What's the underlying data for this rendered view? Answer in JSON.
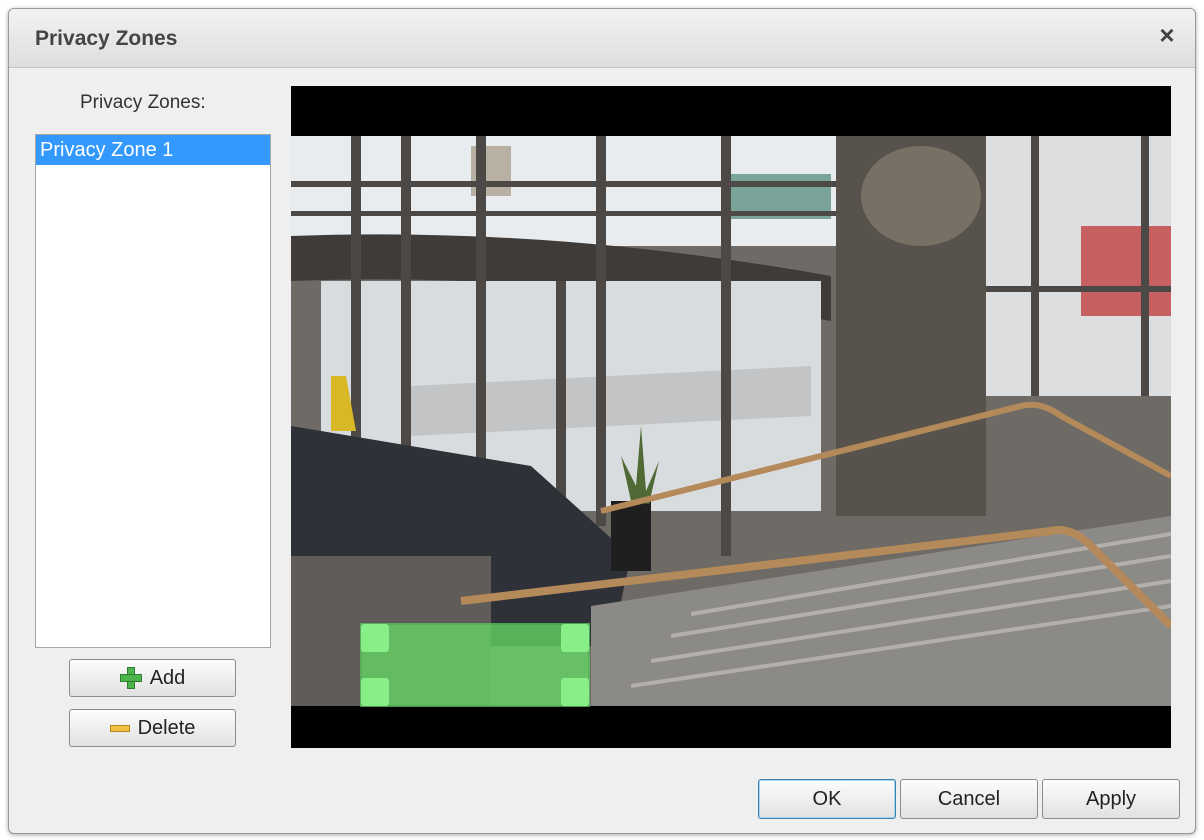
{
  "dialog": {
    "title": "Privacy Zones",
    "close_glyph": "×"
  },
  "sidebar": {
    "label": "Privacy Zones:",
    "zones": [
      "Privacy Zone 1"
    ],
    "add_label": "Add",
    "delete_label": "Delete"
  },
  "video": {
    "privacy_zone_color": "#66dd66"
  },
  "footer": {
    "ok_label": "OK",
    "cancel_label": "Cancel",
    "apply_label": "Apply"
  },
  "colors": {
    "selection": "#3399ff",
    "add_icon": "#4db34d",
    "delete_icon": "#f0c040"
  },
  "icons": {
    "close": "close-icon",
    "add": "plus-icon",
    "delete": "minus-icon"
  }
}
